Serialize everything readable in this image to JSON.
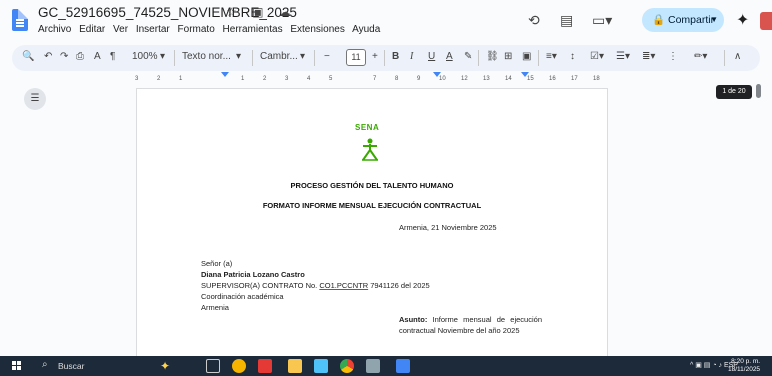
{
  "window": {
    "doc_title": "GC_52916695_74525_NOVIEMBRE_2025",
    "title_icons": "☆ ▣ ☁",
    "menu": [
      "Archivo",
      "Editar",
      "Ver",
      "Insertar",
      "Formato",
      "Herramientas",
      "Extensiones",
      "Ayuda"
    ],
    "share_label": "Compartir"
  },
  "toolbar": {
    "zoom": "100%",
    "style": "Texto nor...",
    "font": "Cambr...",
    "font_size": "11",
    "bold": "B",
    "italic": "I",
    "underline": "U",
    "text_color": "A"
  },
  "ruler": {
    "ticks": [
      "3",
      "2",
      "1",
      "1",
      "2",
      "3",
      "4",
      "5",
      "7",
      "8",
      "9",
      "10",
      "12",
      "13",
      "14",
      "15",
      "16",
      "17",
      "18"
    ]
  },
  "document": {
    "heading1": "PROCESO GESTIÓN DEL TALENTO HUMANO",
    "heading2": "FORMATO INFORME MENSUAL EJECUCIÓN CONTRACTUAL",
    "place_date": "Armenia, 21 Noviembre 2025",
    "salutation": "Señor (a)",
    "recipient_name": "Diana Patricia Lozano Castro",
    "recipient_role_prefix": "SUPERVISOR(A) CONTRATO No. ",
    "contract_code": "CO1.PCCNTR",
    "contract_suffix": " 7941126 del 2025",
    "department": "Coordinación académica",
    "city": "Armenia",
    "asunto_label": "Asunto:",
    "asunto_text": "Informe mensual de ejecución contractual Noviembre del año 2025",
    "logo_text": "SENA"
  },
  "page_counter": "1 de 20",
  "taskbar": {
    "search_placeholder": "Buscar",
    "language": "ESP",
    "time": "8:20 p. m.",
    "date": "18/11/2025"
  },
  "colors": {
    "accent": "#4285f4",
    "share_bg": "#c2e7ff",
    "sena_green": "#39a900",
    "taskbar": "#1c2a3a"
  }
}
